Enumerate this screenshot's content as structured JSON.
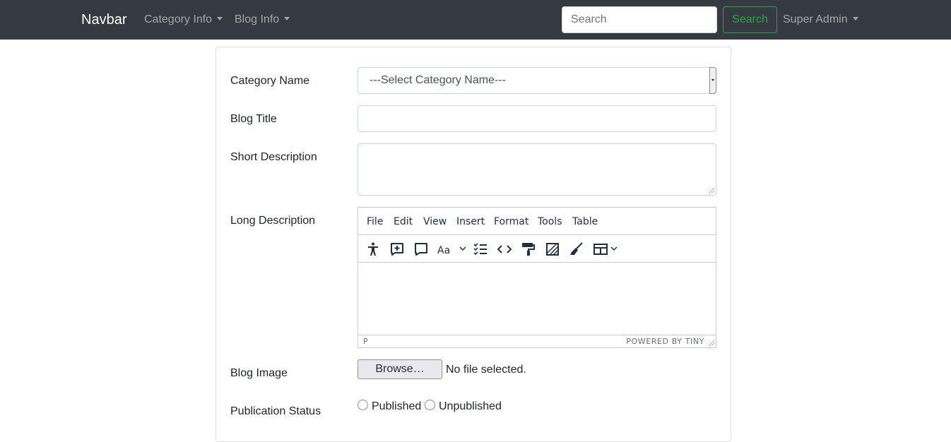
{
  "navbar": {
    "brand": "Navbar",
    "menus": [
      {
        "label": "Category Info"
      },
      {
        "label": "Blog Info"
      }
    ],
    "search": {
      "placeholder": "Search",
      "button": "Search"
    },
    "user_menu": "Super Admin",
    "colors": {
      "background": "#343a40",
      "search_button": "#28a745"
    }
  },
  "form": {
    "category": {
      "label": "Category Name",
      "selected": "---Select Category Name---"
    },
    "title": {
      "label": "Blog Title",
      "value": ""
    },
    "short_description": {
      "label": "Short Description",
      "value": ""
    },
    "long_description": {
      "label": "Long Description",
      "menubar": [
        "File",
        "Edit",
        "View",
        "Insert",
        "Format",
        "Tools",
        "Table"
      ],
      "toolbar_icons": [
        "accessibility-icon",
        "add-comment-icon",
        "comment-icon",
        "font-format-icon",
        "checklist-icon",
        "source-code-icon",
        "format-painter-icon",
        "image-tools-icon",
        "clear-format-icon",
        "table-icon"
      ],
      "status_path": "P",
      "branding": "POWERED BY TINY"
    },
    "image": {
      "label": "Blog Image",
      "button": "Browse…",
      "status": "No file selected."
    },
    "publication": {
      "label": "Publication Status",
      "options": [
        {
          "label": "Published",
          "checked": false
        },
        {
          "label": "Unpublished",
          "checked": false
        }
      ]
    }
  }
}
